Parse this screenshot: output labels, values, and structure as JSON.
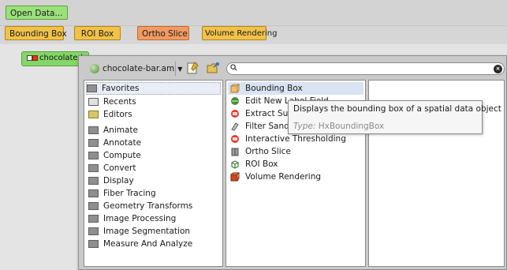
{
  "toolbar": {
    "open_data": "Open Data..."
  },
  "module_buttons": {
    "bounding_box": "Bounding Box",
    "roi_box": "ROI Box",
    "ortho_slice": "Ortho Slice",
    "volume_rendering": "Volume Rendering"
  },
  "data_node": {
    "label": "chocolate-bar.am"
  },
  "popup": {
    "object_selector": "chocolate-bar.am",
    "search_placeholder": "",
    "categories": [
      {
        "label": "Favorites"
      },
      {
        "label": "Recents"
      },
      {
        "label": "Editors"
      },
      {
        "label": "Animate"
      },
      {
        "label": "Annotate"
      },
      {
        "label": "Compute"
      },
      {
        "label": "Convert"
      },
      {
        "label": "Display"
      },
      {
        "label": "Fiber Tracing"
      },
      {
        "label": "Geometry Transforms"
      },
      {
        "label": "Image Processing"
      },
      {
        "label": "Image Segmentation"
      },
      {
        "label": "Measure And Analyze"
      }
    ],
    "modules": [
      {
        "label": "Bounding Box"
      },
      {
        "label": "Edit New Label Field"
      },
      {
        "label": "Extract Subvolume"
      },
      {
        "label": "Filter Sandbox"
      },
      {
        "label": "Interactive Thresholding"
      },
      {
        "label": "Ortho Slice"
      },
      {
        "label": "ROI Box"
      },
      {
        "label": "Volume Rendering"
      }
    ]
  },
  "tooltip": {
    "description": "Displays the bounding box of a spatial data object",
    "type_label": "Type:",
    "type_value": "HxBoundingBox"
  },
  "colors": {
    "green_button": "#9be07b",
    "yellow_button": "#f0c24a",
    "orange_button": "#f29a62",
    "selection": "#e9eef6"
  }
}
